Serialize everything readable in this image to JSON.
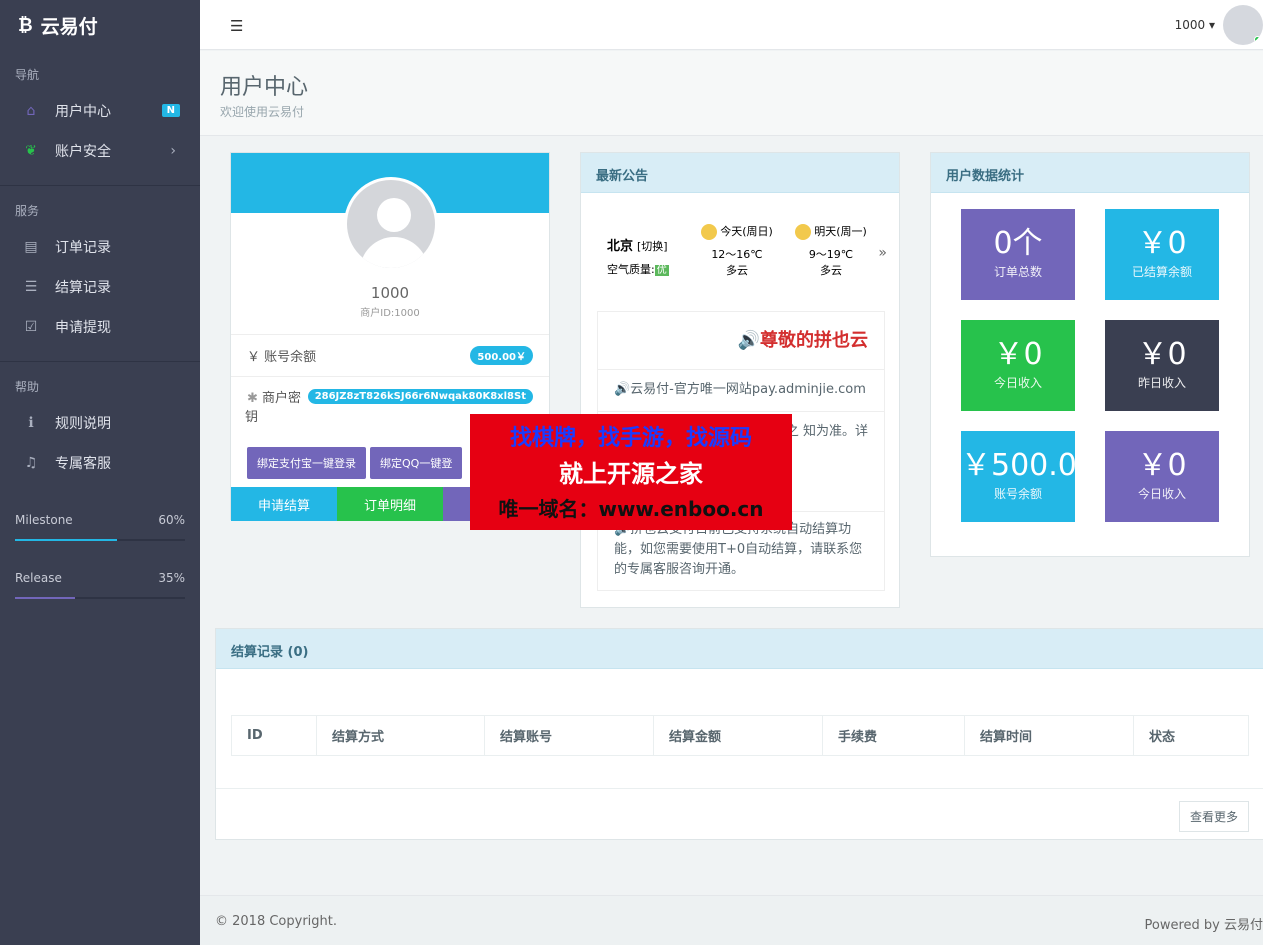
{
  "brand": {
    "name": "云易付",
    "icon": "bitcoin-icon"
  },
  "sidebar": {
    "section_nav": "导航",
    "section_service": "服务",
    "section_help": "帮助",
    "items": [
      {
        "label": "用户中心",
        "icon": "home-icon",
        "badge": "N"
      },
      {
        "label": "账户安全",
        "icon": "leaf-icon"
      },
      {
        "label": "订单记录",
        "icon": "list-icon"
      },
      {
        "label": "结算记录",
        "icon": "grid-icon"
      },
      {
        "label": "申请提现",
        "icon": "check-square-icon"
      },
      {
        "label": "规则说明",
        "icon": "info-icon"
      },
      {
        "label": "专属客服",
        "icon": "bell-icon"
      }
    ],
    "progress": [
      {
        "label": "Milestone",
        "value": "60%",
        "fraction": 0.6,
        "color": "#23b7e5"
      },
      {
        "label": "Release",
        "value": "35%",
        "fraction": 0.35,
        "color": "#7266ba"
      }
    ]
  },
  "header": {
    "user": "1000 ▾"
  },
  "page": {
    "title": "用户中心",
    "subtitle": "欢迎使用云易付"
  },
  "profile": {
    "name": "1000",
    "merchant_id": "商户ID:1000",
    "balance_label": "账号余额",
    "balance_value": "500.00￥",
    "key_label_1": "商户密",
    "key_label_2": "钥",
    "key_value": "286JZ8zT826kSJ66r6Nwqak80K8xl8St",
    "btn_alipay": "绑定支付宝一键登录",
    "btn_qq": "绑定QQ一键登",
    "tab_settle": "申请结算",
    "tab_orders": "订单明细",
    "tab_third": "更"
  },
  "notice": {
    "title": "最新公告",
    "weather": {
      "city": "北京",
      "switch": "[切换]",
      "air_label": "空气质量:",
      "air_value": "优",
      "today_label": "今天(周日)",
      "today_temp": "12～16℃",
      "today_desc": "多云",
      "tomorrow_label": "明天(周一)",
      "tomorrow_temp": "9～19℃",
      "tomorrow_desc": "多云",
      "more": "»"
    },
    "marquee": "🔊尊敬的拼也云",
    "site": "🔊云易付-官方唯一网站pay.adminjie.com",
    "item1": "统一结算记 1-2小时之 知为准。详",
    "item2": "🔊拼也云支付目前已支持系统自动结算功能，如您需要使用T+0自动结算，请联系您的专属客服咨询开通。"
  },
  "stats": {
    "title": "用户数据统计",
    "cards": [
      {
        "value": "0个",
        "label": "订单总数",
        "color": "#7266ba"
      },
      {
        "value": "￥0",
        "label": "已结算余额",
        "color": "#23b7e5"
      },
      {
        "value": "￥0",
        "label": "今日收入",
        "color": "#27c24c"
      },
      {
        "value": "￥0",
        "label": "昨日收入",
        "color": "#3a3f51"
      },
      {
        "value": "￥500.0",
        "label": "账号余额",
        "color": "#23b7e5"
      },
      {
        "value": "￥0",
        "label": "今日收入",
        "color": "#7266ba"
      }
    ]
  },
  "settlement": {
    "title": "结算记录 (0)",
    "columns": [
      "ID",
      "结算方式",
      "结算账号",
      "结算金额",
      "手续费",
      "结算时间",
      "状态"
    ],
    "more_button": "查看更多"
  },
  "footer": {
    "copyright": "© 2018 Copyright.",
    "powered": "Powered by 云易付"
  },
  "watermark": {
    "line1": "找棋牌，找手游，找源码",
    "line2": "就上开源之家",
    "line3": "唯一域名：www.enboo.cn"
  }
}
